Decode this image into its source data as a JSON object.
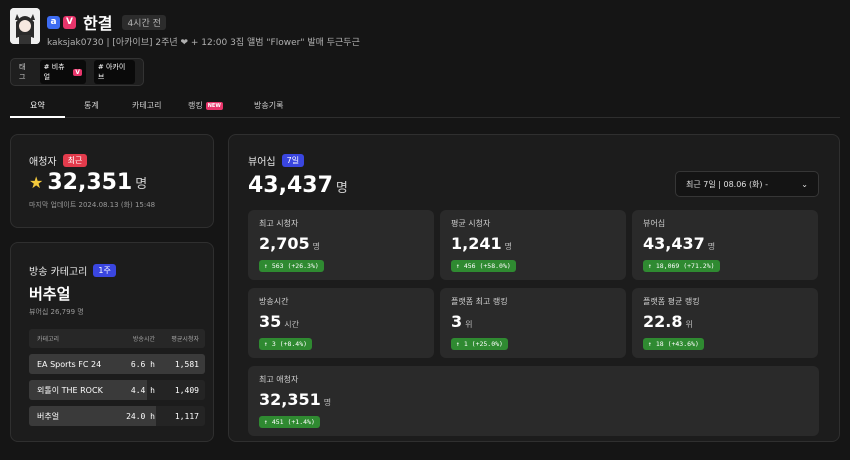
{
  "header": {
    "badge_a": "a",
    "badge_v": "V",
    "name": "한결",
    "live_time": "4시간 전",
    "description": "kaksjak0730 | [아카이브] 2주년 ❤ + 12:00 3집 앨범 \"Flower\" 발매 두근두근"
  },
  "tags": {
    "label": "태그",
    "items": [
      "# 비츄얼",
      "# 아카이브"
    ],
    "v_badge": "V"
  },
  "tabs": [
    {
      "label": "요약",
      "active": true
    },
    {
      "label": "통계"
    },
    {
      "label": "카테고리"
    },
    {
      "label": "랭킹",
      "badge": "NEW"
    },
    {
      "label": "방송기록"
    }
  ],
  "viewers": {
    "title": "애청자",
    "badge": "최근",
    "value": "32,351",
    "unit": "명",
    "updated": "마지막 업데이트 2024.08.13 (화) 15:48"
  },
  "category": {
    "title": "방송 카테고리",
    "badge": "1주",
    "name": "버추얼",
    "viewership": "뷰어십 26,799 명",
    "headers": [
      "카테고리",
      "방송시간",
      "평균시청자"
    ],
    "rows": [
      {
        "name": "EA Sports FC 24",
        "hours": "6.6 h",
        "avg": "1,581",
        "fill": 1.0
      },
      {
        "name": "외톨이 THE ROCK",
        "hours": "4.4 h",
        "avg": "1,409",
        "fill": 0.67
      },
      {
        "name": "버추얼",
        "hours": "24.0 h",
        "avg": "1,117",
        "fill": 0.72
      }
    ]
  },
  "viewership": {
    "title": "뷰어십",
    "badge": "7일",
    "value": "43,437",
    "unit": "명",
    "dropdown": "최근 7일 | 08.06 (화) -",
    "dropdown_icon": "chevron-down-icon"
  },
  "stats": [
    {
      "label": "최고 시청자",
      "value": "2,705",
      "unit": "명",
      "change": "↑ 563 (+26.3%)"
    },
    {
      "label": "평균 시청자",
      "value": "1,241",
      "unit": "명",
      "change": "↑ 456 (+58.0%)"
    },
    {
      "label": "뷰어십",
      "value": "43,437",
      "unit": "명",
      "change": "↑ 18,069 (+71.2%)"
    },
    {
      "label": "방송시간",
      "value": "35",
      "unit": "시간",
      "change": "↑ 3 (+8.4%)"
    },
    {
      "label": "플랫폼 최고 랭킹",
      "value": "3",
      "unit": "위",
      "change": "↑ 1 (+25.0%)"
    },
    {
      "label": "플랫폼 평균 랭킹",
      "value": "22.8",
      "unit": "위",
      "change": "↑ 18 (+43.6%)"
    },
    {
      "label": "최고 애청자",
      "value": "32,351",
      "unit": "명",
      "change": "↑ 451 (+1.4%)"
    }
  ],
  "colors": {
    "background": "#151515",
    "panel": "#1c1c1c",
    "card": "#2a2a2a",
    "accent_red": "#e33b4c",
    "accent_blue": "#3a46e0",
    "positive": "#2f8a31"
  }
}
